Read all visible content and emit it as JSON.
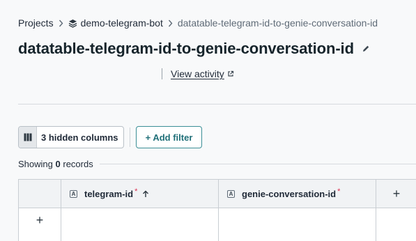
{
  "breadcrumb": {
    "projects": "Projects",
    "project": "demo-telegram-bot",
    "current": "datatable-telegram-id-to-genie-conversation-id"
  },
  "page": {
    "title": "datatable-telegram-id-to-genie-conversation-id",
    "view_activity": "View activity"
  },
  "toolbar": {
    "hidden_columns": "3 hidden columns",
    "add_filter": "+ Add filter"
  },
  "records": {
    "prefix": "Showing",
    "count": "0",
    "suffix": "records"
  },
  "table": {
    "columns": [
      {
        "type_icon": "A",
        "name": "telegram-id",
        "required_mark": "*",
        "sorted": "ascending",
        "sort_icon": "arrow-up-icon"
      },
      {
        "type_icon": "A",
        "name": "genie-conversation-id",
        "required_mark": "*"
      }
    ],
    "add_column_symbol": "+",
    "add_row_symbol": "+"
  },
  "colors": {
    "accent": "#1f6f78",
    "required": "#d9304f",
    "title": "#16242b"
  }
}
